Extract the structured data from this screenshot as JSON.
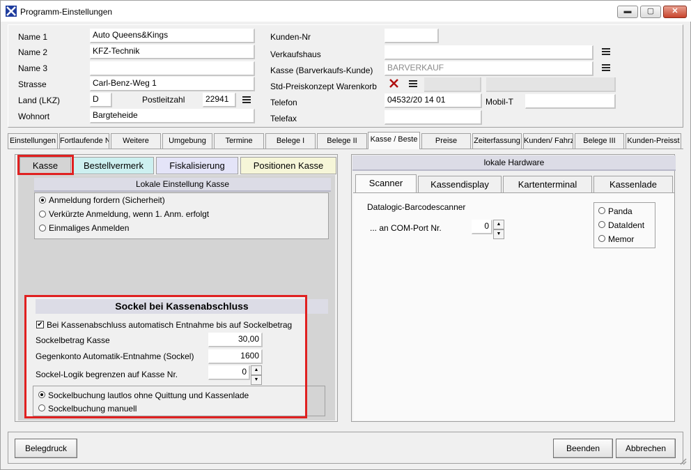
{
  "window": {
    "title": "Programm-Einstellungen",
    "minimize": "▬",
    "maximize": "▢",
    "close": "✕"
  },
  "header": {
    "name1": {
      "label": "Name 1",
      "value": "Auto Queens&Kings"
    },
    "name2": {
      "label": "Name 2",
      "value": "KFZ-Technik"
    },
    "name3": {
      "label": "Name 3",
      "value": ""
    },
    "strasse": {
      "label": "Strasse",
      "value": "Carl-Benz-Weg 1"
    },
    "land": {
      "label": "Land (LKZ)",
      "value": "D"
    },
    "plz": {
      "label": "Postleitzahl",
      "value": "22941"
    },
    "wohnort": {
      "label": "Wohnort",
      "value": "Bargteheide"
    },
    "kundennr": {
      "label": "Kunden-Nr",
      "value": ""
    },
    "verkaufshaus": {
      "label": "Verkaufshaus",
      "value": ""
    },
    "kasse_kunde": {
      "label": "Kasse (Barverkaufs-Kunde)",
      "value": "BARVERKAUF"
    },
    "preiskonzept": {
      "label": "Std-Preiskonzept Warenkorb"
    },
    "telefon": {
      "label": "Telefon",
      "value": "04532/20 14 01"
    },
    "mobil": {
      "label": "Mobil-T",
      "value": ""
    },
    "telefax": {
      "label": "Telefax",
      "value": ""
    }
  },
  "tabs": [
    "Einstellungen",
    "Fortlaufende N",
    "Weitere",
    "Umgebung",
    "Termine",
    "Belege I",
    "Belege II",
    "Kasse / Beste",
    "Preise",
    "Zeiterfassung",
    "Kunden/ Fahrz",
    "Belege III",
    "Kunden-Preisst"
  ],
  "left": {
    "subtabs": [
      "Kasse",
      "Bestellvermerk",
      "Fiskalisierung",
      "Positionen Kasse"
    ],
    "local_title": "Lokale Einstellung Kasse",
    "login_options": [
      "Anmeldung fordern (Sicherheit)",
      "Verkürzte Anmeldung, wenn 1. Anm. erfolgt",
      "Einmaliges Anmelden"
    ],
    "sockel_title": "Sockel bei Kassenabschluss",
    "auto_entnahme": "Bei Kassenabschluss automatisch Entnahme bis auf Sockelbetrag",
    "sockelbetrag": {
      "label": "Sockelbetrag Kasse",
      "value": "30,00"
    },
    "gegenkonto": {
      "label": "Gegenkonto Automatik-Entnahme (Sockel)",
      "value": "1600"
    },
    "sockel_logik": {
      "label": "Sockel-Logik begrenzen auf Kasse Nr.",
      "value": "0"
    },
    "buchung_options": [
      "Sockelbuchung lautlos ohne Quittung und Kassenlade",
      "Sockelbuchung manuell"
    ]
  },
  "right": {
    "title": "lokale Hardware",
    "subtabs": [
      "Scanner",
      "Kassendisplay",
      "Kartenterminal",
      "Kassenlade"
    ],
    "scanner_label": "Datalogic-Barcodescanner",
    "comport": {
      "label": "... an COM-Port Nr.",
      "value": "0"
    },
    "scanner_types": [
      "Panda",
      "DataIdent",
      "Memor"
    ]
  },
  "footer": {
    "belegdruck": "Belegdruck",
    "beenden": "Beenden",
    "abbrechen": "Abbrechen"
  }
}
